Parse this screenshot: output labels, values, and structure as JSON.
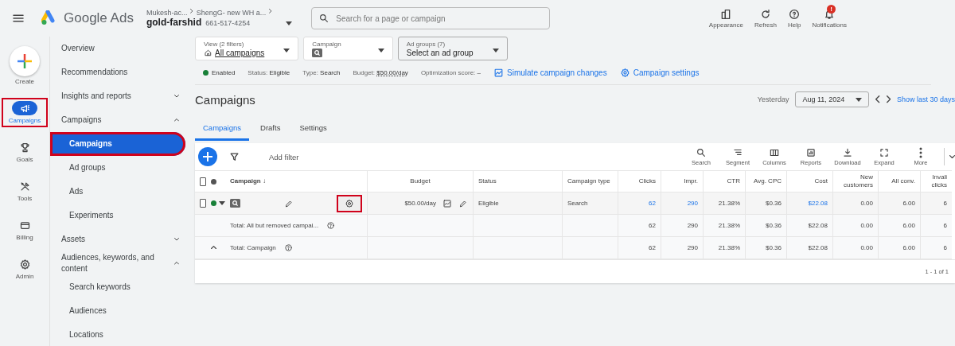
{
  "topbar": {
    "product": "Google Ads",
    "account_path": [
      "Mukesh-ac...",
      "ShengG- new WH a..."
    ],
    "account_name": "gold-farshid",
    "account_id": "661-517-4254",
    "search": {
      "placeholder": "Search for a page or campaign"
    },
    "actions": [
      {
        "label": "Appearance",
        "kind": "appearance"
      },
      {
        "label": "Refresh",
        "kind": "refresh"
      },
      {
        "label": "Help",
        "kind": "help"
      },
      {
        "label": "Notifications",
        "kind": "bell",
        "badge": "!"
      }
    ]
  },
  "rail": [
    {
      "label": "Create",
      "kind": "create",
      "selected": false,
      "highlighted": false
    },
    {
      "label": "Campaigns",
      "kind": "megaphone",
      "selected": true,
      "highlighted": true
    },
    {
      "label": "Goals",
      "kind": "trophy",
      "selected": false,
      "highlighted": false
    },
    {
      "label": "Tools",
      "kind": "tools",
      "selected": false,
      "highlighted": false
    },
    {
      "label": "Billing",
      "kind": "card",
      "selected": false,
      "highlighted": false
    },
    {
      "label": "Admin",
      "kind": "gear",
      "selected": false,
      "highlighted": false
    }
  ],
  "nav": [
    {
      "label": "Overview"
    },
    {
      "label": "Recommendations"
    },
    {
      "label": "Insights and reports",
      "expanded": false
    },
    {
      "label": "Campaigns",
      "expanded": true,
      "children": [
        {
          "label": "Campaigns",
          "selected": true,
          "highlighted": true
        },
        {
          "label": "Ad groups",
          "selected": false,
          "highlighted": false
        },
        {
          "label": "Ads",
          "selected": false,
          "highlighted": false
        },
        {
          "label": "Experiments",
          "selected": false,
          "highlighted": false
        }
      ]
    },
    {
      "label": "Assets",
      "expanded": false
    },
    {
      "label": "Audiences, keywords, and content",
      "expanded": true,
      "children": [
        {
          "label": "Search keywords",
          "selected": false,
          "highlighted": false
        },
        {
          "label": "Audiences",
          "selected": false,
          "highlighted": false
        },
        {
          "label": "Locations",
          "selected": false,
          "highlighted": false
        }
      ]
    }
  ],
  "filters": [
    {
      "label": "View (2 filters)",
      "value": "All campaigns",
      "kind": "view"
    },
    {
      "label": "Campaign",
      "kind": "campaign"
    },
    {
      "label": "Ad groups (7)",
      "value": "Select an ad group",
      "kind": "adgroup"
    }
  ],
  "summary": {
    "status": "Enabled",
    "fields": [
      {
        "label": "Status:",
        "value": "Eligible"
      },
      {
        "label": "Type:",
        "value": "Search"
      },
      {
        "label": "Budget:",
        "value": "$50.00/day"
      },
      {
        "label": "Optimization score:",
        "value": "–"
      }
    ],
    "links": [
      {
        "label": "Simulate campaign changes",
        "kind": "chart"
      },
      {
        "label": "Campaign settings",
        "kind": "gear"
      }
    ]
  },
  "page_title": "Campaigns",
  "date": {
    "label": "Yesterday",
    "value": "Aug 11, 2024",
    "link": "Show last 30 days"
  },
  "tabs": [
    {
      "label": "Campaigns",
      "selected": true
    },
    {
      "label": "Drafts",
      "selected": false
    },
    {
      "label": "Settings",
      "selected": false
    }
  ],
  "toolbar": {
    "add_filter": "Add filter",
    "tools": [
      {
        "label": "Search",
        "kind": "search"
      },
      {
        "label": "Segment",
        "kind": "segment"
      },
      {
        "label": "Columns",
        "kind": "columns"
      },
      {
        "label": "Reports",
        "kind": "reports"
      },
      {
        "label": "Download",
        "kind": "download"
      },
      {
        "label": "Expand",
        "kind": "expand"
      },
      {
        "label": "More",
        "kind": "more"
      }
    ]
  },
  "table": {
    "columns": [
      "Campaign ↓",
      "Budget",
      "Status",
      "Campaign type",
      "Clicks",
      "Impr.",
      "CTR",
      "Avg. CPC",
      "Cost",
      "New customers",
      "All conv.",
      "Invali clicks"
    ],
    "select_all_checked": false,
    "rows": [
      {
        "kind": "campaign",
        "checked": false,
        "gear_highlighted": true,
        "budget": "$50.00/day",
        "status": "Eligible",
        "type": "Search",
        "metrics": [
          {
            "text": "62",
            "link": true
          },
          {
            "text": "290",
            "link": true
          },
          {
            "text": "21.38%",
            "link": false
          },
          {
            "text": "$0.36",
            "link": false
          },
          {
            "text": "$22.08",
            "link": true
          },
          {
            "text": "0.00",
            "link": false
          },
          {
            "text": "6.00",
            "link": false
          },
          {
            "text": "6",
            "link": false
          }
        ]
      },
      {
        "kind": "total",
        "label": "Total: All but removed campai...",
        "metrics": [
          {
            "text": "62",
            "link": false
          },
          {
            "text": "290",
            "link": false
          },
          {
            "text": "21.38%",
            "link": false
          },
          {
            "text": "$0.36",
            "link": false
          },
          {
            "text": "$22.08",
            "link": false
          },
          {
            "text": "0.00",
            "link": false
          },
          {
            "text": "6.00",
            "link": false
          },
          {
            "text": "6",
            "link": false
          }
        ]
      },
      {
        "kind": "grand_total",
        "label": "Total: Campaign",
        "metrics": [
          {
            "text": "62",
            "link": false
          },
          {
            "text": "290",
            "link": false
          },
          {
            "text": "21.38%",
            "link": false
          },
          {
            "text": "$0.36",
            "link": false
          },
          {
            "text": "$22.08",
            "link": false
          },
          {
            "text": "0.00",
            "link": false
          },
          {
            "text": "6.00",
            "link": false
          },
          {
            "text": "6",
            "link": false
          }
        ]
      }
    ],
    "pagination": "1 - 1 of 1"
  }
}
